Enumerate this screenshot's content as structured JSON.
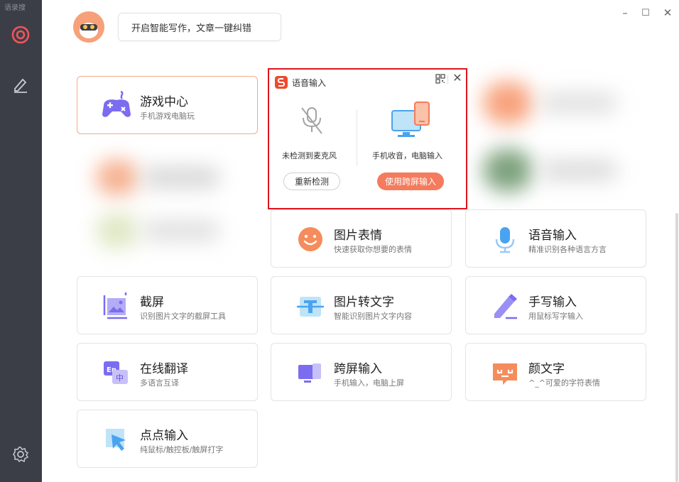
{
  "sidebar": {
    "top_text": "语录搜",
    "items": [
      {
        "icon": "target-icon"
      },
      {
        "icon": "writing-pen-icon"
      },
      {
        "icon": "gear-icon"
      }
    ]
  },
  "window": {
    "minimize": "–",
    "maximize": "☐",
    "close": "✕"
  },
  "header": {
    "bubble_text": "开启智能写作，文章一键纠错"
  },
  "cards": [
    {
      "title": "游戏中心",
      "sub": "手机游戏电脑玩",
      "icon": "gamepad-icon"
    },
    {
      "title": "图片表情",
      "sub": "快速获取你想要的表情",
      "icon": "smiley-icon"
    },
    {
      "title": "语音输入",
      "sub": "精准识别各种语言方言",
      "icon": "microphone-icon"
    },
    {
      "title": "截屏",
      "sub": "识别图片文字的截屏工具",
      "icon": "screenshot-icon"
    },
    {
      "title": "图片转文字",
      "sub": "智能识别图片文字内容",
      "icon": "image-to-text-icon"
    },
    {
      "title": "手写输入",
      "sub": "用鼠标写字输入",
      "icon": "pen-icon"
    },
    {
      "title": "在线翻译",
      "sub": "多语言互译",
      "icon": "translate-icon"
    },
    {
      "title": "跨屏输入",
      "sub": "手机输入，电脑上屏",
      "icon": "cross-screen-icon"
    },
    {
      "title": "颜文字",
      "sub": "^_^可爱的字符表情",
      "icon": "emoticon-icon"
    },
    {
      "title": "点点输入",
      "sub": "纯鼠标/触控板/触屏打字",
      "icon": "cursor-click-icon"
    }
  ],
  "popup": {
    "title": "语音输入",
    "left_status": "未检测到麦克风",
    "right_status": "手机收音，电脑输入",
    "retry_button": "重新检测",
    "cross_button": "使用跨屏输入",
    "close": "✕"
  },
  "colors": {
    "accent": "#f47b5d",
    "sidebar_bg": "#3c3e47",
    "highlight_border": "#e0141e",
    "icon_purple": "#7b6cf0",
    "icon_blue": "#4aa3f0",
    "icon_orange": "#f58c5b"
  }
}
